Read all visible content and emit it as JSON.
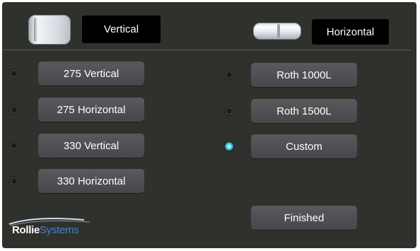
{
  "header": {
    "vertical_label": "Vertical",
    "horizontal_label": "Horizontal",
    "vertical_icon": "vertical-tank-icon",
    "horizontal_icon": "horizontal-tank-icon"
  },
  "left_options": [
    {
      "label": "275 Vertical",
      "selected": false
    },
    {
      "label": "275 Horizontal",
      "selected": false
    },
    {
      "label": "330  Vertical",
      "selected": false
    },
    {
      "label": "330 Horizontal",
      "selected": false
    }
  ],
  "right_options": [
    {
      "label": "Roth 1000L",
      "selected": false
    },
    {
      "label": "Roth 1500L",
      "selected": false
    },
    {
      "label": "Custom",
      "selected": true
    }
  ],
  "finished_label": "Finished",
  "logo": {
    "part1": "Rollie",
    "part2": "Systems"
  },
  "colors": {
    "panel": "#2f312c",
    "button": "#4f4f53",
    "radio_active": "#4fd6ea",
    "logo_blue": "#4a7fc9"
  }
}
